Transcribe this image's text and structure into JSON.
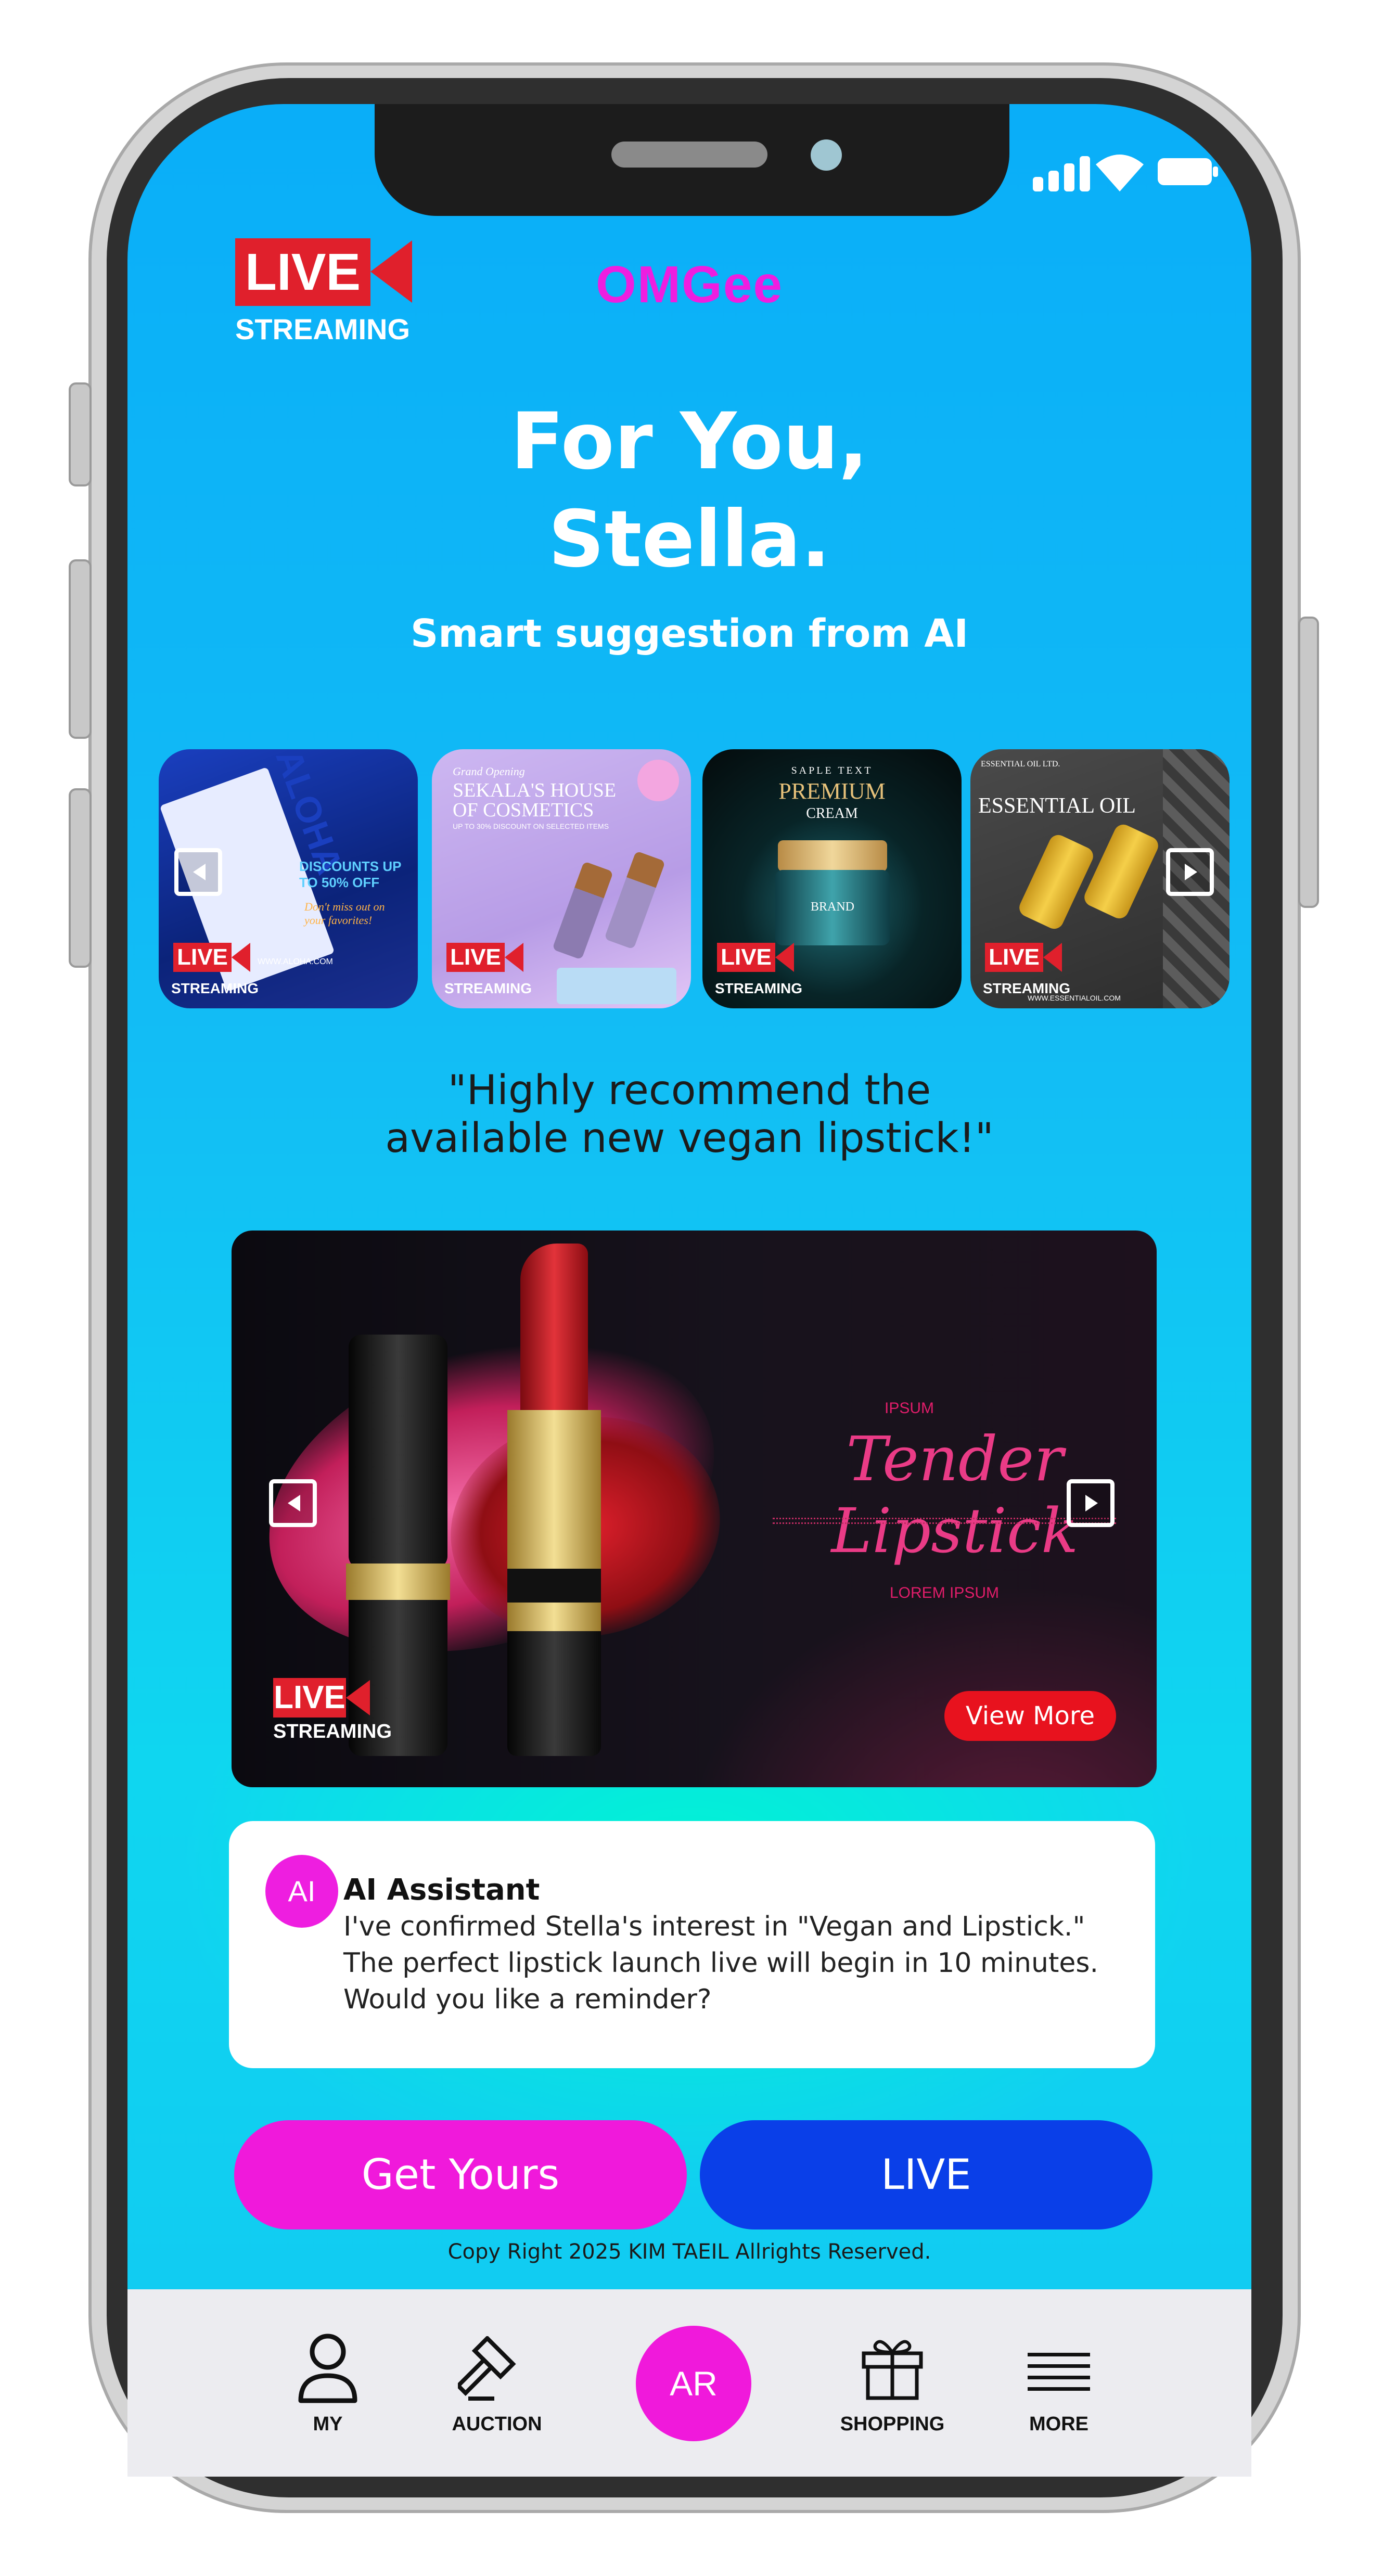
{
  "header": {
    "live_logo_main": "LIVE",
    "live_logo_sub": "STREAMING",
    "brand": "OMGee"
  },
  "hero": {
    "title_line1": "For You,",
    "title_line2": "Stella.",
    "subtitle": "Smart suggestion from AI"
  },
  "thumbnails": [
    {
      "text_main": "DISCOUNTS UP TO 50% OFF",
      "text_sub": "Don't miss out on your favorites!",
      "url": "WWW.ALOHA.COM",
      "brand": "ALOHA",
      "live": "LIVE",
      "streaming": "STREAMING"
    },
    {
      "text_main": "SEKALA'S HOUSE OF COSMETICS",
      "text_top": "Grand Opening",
      "text_sub": "UP TO 30% DISCOUNT ON SELECTED ITEMS",
      "live": "LIVE",
      "streaming": "STREAMING"
    },
    {
      "text_top": "SAPLE TEXT",
      "text_main": "PREMIUM",
      "text_sub": "CREAM",
      "label": "BRAND",
      "live": "LIVE",
      "streaming": "STREAMING"
    },
    {
      "text_top": "ESSENTIAL OIL LTD.",
      "text_main": "ESSENTIAL OIL",
      "url": "WWW.ESSENTIALOIL.COM",
      "live": "LIVE",
      "streaming": "STREAMING"
    }
  ],
  "quote": {
    "line1": "\"Highly recommend the",
    "line2": "available new vegan lipstick!\""
  },
  "banner": {
    "top_label": "IPSUM",
    "title": "Tender Lipstick",
    "bottom_label": "LOREM IPSUM",
    "live": "LIVE",
    "streaming": "STREAMING",
    "view_more": "View More"
  },
  "assistant": {
    "avatar": "AI",
    "name": "AI Assistant",
    "line1": "I've confirmed Stella's interest in \"Vegan and Lipstick.\"",
    "line2": "The perfect lipstick launch live will begin in 10 minutes.",
    "line3": "Would you like a reminder?"
  },
  "actions": {
    "get_yours": "Get Yours",
    "live": "LIVE"
  },
  "footer": {
    "copyright": "Copy Right 2025 KIM TAEIL Allrights Reserved."
  },
  "tabbar": {
    "my": "MY",
    "auction": "AUCTION",
    "ar": "AR",
    "shopping": "SHOPPING",
    "more": "MORE"
  },
  "colors": {
    "accent_magenta": "#f019db",
    "accent_blue": "#0a3fe8",
    "live_red": "#e0202c",
    "background_cyan": "#12bdf5"
  },
  "icons": [
    "signal-icon",
    "wifi-icon",
    "battery-icon",
    "play-left-icon",
    "play-right-icon",
    "user-icon",
    "gavel-icon",
    "gift-icon",
    "menu-icon"
  ]
}
